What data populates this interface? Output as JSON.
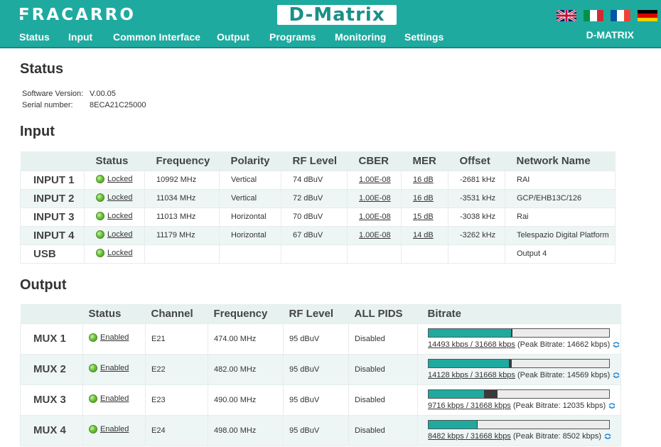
{
  "header": {
    "brand": "FRACARRO",
    "product": "D-Matrix",
    "device_name": "D-MATRIX",
    "colors": {
      "teal": "#1faaa0",
      "white": "#ffffff"
    },
    "nav": [
      "Status",
      "Input",
      "Common Interface",
      "Output",
      "Programs",
      "Monitoring",
      "Settings"
    ],
    "languages": [
      "en-flag-icon",
      "it-flag-icon",
      "fr-flag-icon",
      "de-flag-icon"
    ]
  },
  "status": {
    "title": "Status",
    "software_version_label": "Software Version:",
    "software_version": "V.00.05",
    "serial_number_label": "Serial number:",
    "serial_number": "8ECA21C25000"
  },
  "input": {
    "title": "Input",
    "columns": [
      "Status",
      "Frequency",
      "Polarity",
      "RF Level",
      "CBER",
      "MER",
      "Offset",
      "Network Name"
    ],
    "rows": [
      {
        "name": "INPUT 1",
        "status": "Locked",
        "frequency": "10992 MHz",
        "polarity": "Vertical",
        "rf_level": "74 dBuV",
        "cber": "1.00E-08",
        "mer": "16 dB",
        "offset": "-2681 kHz",
        "network": "RAI"
      },
      {
        "name": "INPUT 2",
        "status": "Locked",
        "frequency": "11034 MHz",
        "polarity": "Vertical",
        "rf_level": "72 dBuV",
        "cber": "1.00E-08",
        "mer": "16 dB",
        "offset": "-3531 kHz",
        "network": "GCP/EHB13C/126"
      },
      {
        "name": "INPUT 3",
        "status": "Locked",
        "frequency": "11013 MHz",
        "polarity": "Horizontal",
        "rf_level": "70 dBuV",
        "cber": "1.00E-08",
        "mer": "15 dB",
        "offset": "-3038 kHz",
        "network": "Rai"
      },
      {
        "name": "INPUT 4",
        "status": "Locked",
        "frequency": "11179 MHz",
        "polarity": "Horizontal",
        "rf_level": "67 dBuV",
        "cber": "1.00E-08",
        "mer": "14 dB",
        "offset": "-3262 kHz",
        "network": "Telespazio Digital Platform"
      },
      {
        "name": "USB",
        "status": "Locked",
        "frequency": "",
        "polarity": "",
        "rf_level": "",
        "cber": "",
        "mer": "",
        "offset": "",
        "network": "Output 4"
      }
    ]
  },
  "output": {
    "title": "Output",
    "columns": [
      "Status",
      "Channel",
      "Frequency",
      "RF Level",
      "ALL PIDS",
      "Bitrate"
    ],
    "rows": [
      {
        "name": "MUX 1",
        "status": "Enabled",
        "channel": "E21",
        "frequency": "474.00 MHz",
        "rf_level": "95 dBuV",
        "all_pids": "Disabled",
        "bitrate_link": "14493 kbps / 31668 kbps",
        "peak_text": " (Peak Bitrate: 14662 kbps)",
        "current_kbps": 14493,
        "peak_kbps": 14662,
        "max_kbps": 31668
      },
      {
        "name": "MUX 2",
        "status": "Enabled",
        "channel": "E22",
        "frequency": "482.00 MHz",
        "rf_level": "95 dBuV",
        "all_pids": "Disabled",
        "bitrate_link": "14128 kbps / 31668 kbps",
        "peak_text": " (Peak Bitrate: 14569 kbps)",
        "current_kbps": 14128,
        "peak_kbps": 14569,
        "max_kbps": 31668
      },
      {
        "name": "MUX 3",
        "status": "Enabled",
        "channel": "E23",
        "frequency": "490.00 MHz",
        "rf_level": "95 dBuV",
        "all_pids": "Disabled",
        "bitrate_link": "9716 kbps / 31668 kbps",
        "peak_text": " (Peak Bitrate: 12035 kbps)",
        "current_kbps": 9716,
        "peak_kbps": 12035,
        "max_kbps": 31668
      },
      {
        "name": "MUX 4",
        "status": "Enabled",
        "channel": "E24",
        "frequency": "498.00 MHz",
        "rf_level": "95 dBuV",
        "all_pids": "Disabled",
        "bitrate_link": "8482 kbps / 31668 kbps",
        "peak_text": " (Peak Bitrate: 8502 kbps)",
        "current_kbps": 8482,
        "peak_kbps": 8502,
        "max_kbps": 31668
      }
    ]
  }
}
